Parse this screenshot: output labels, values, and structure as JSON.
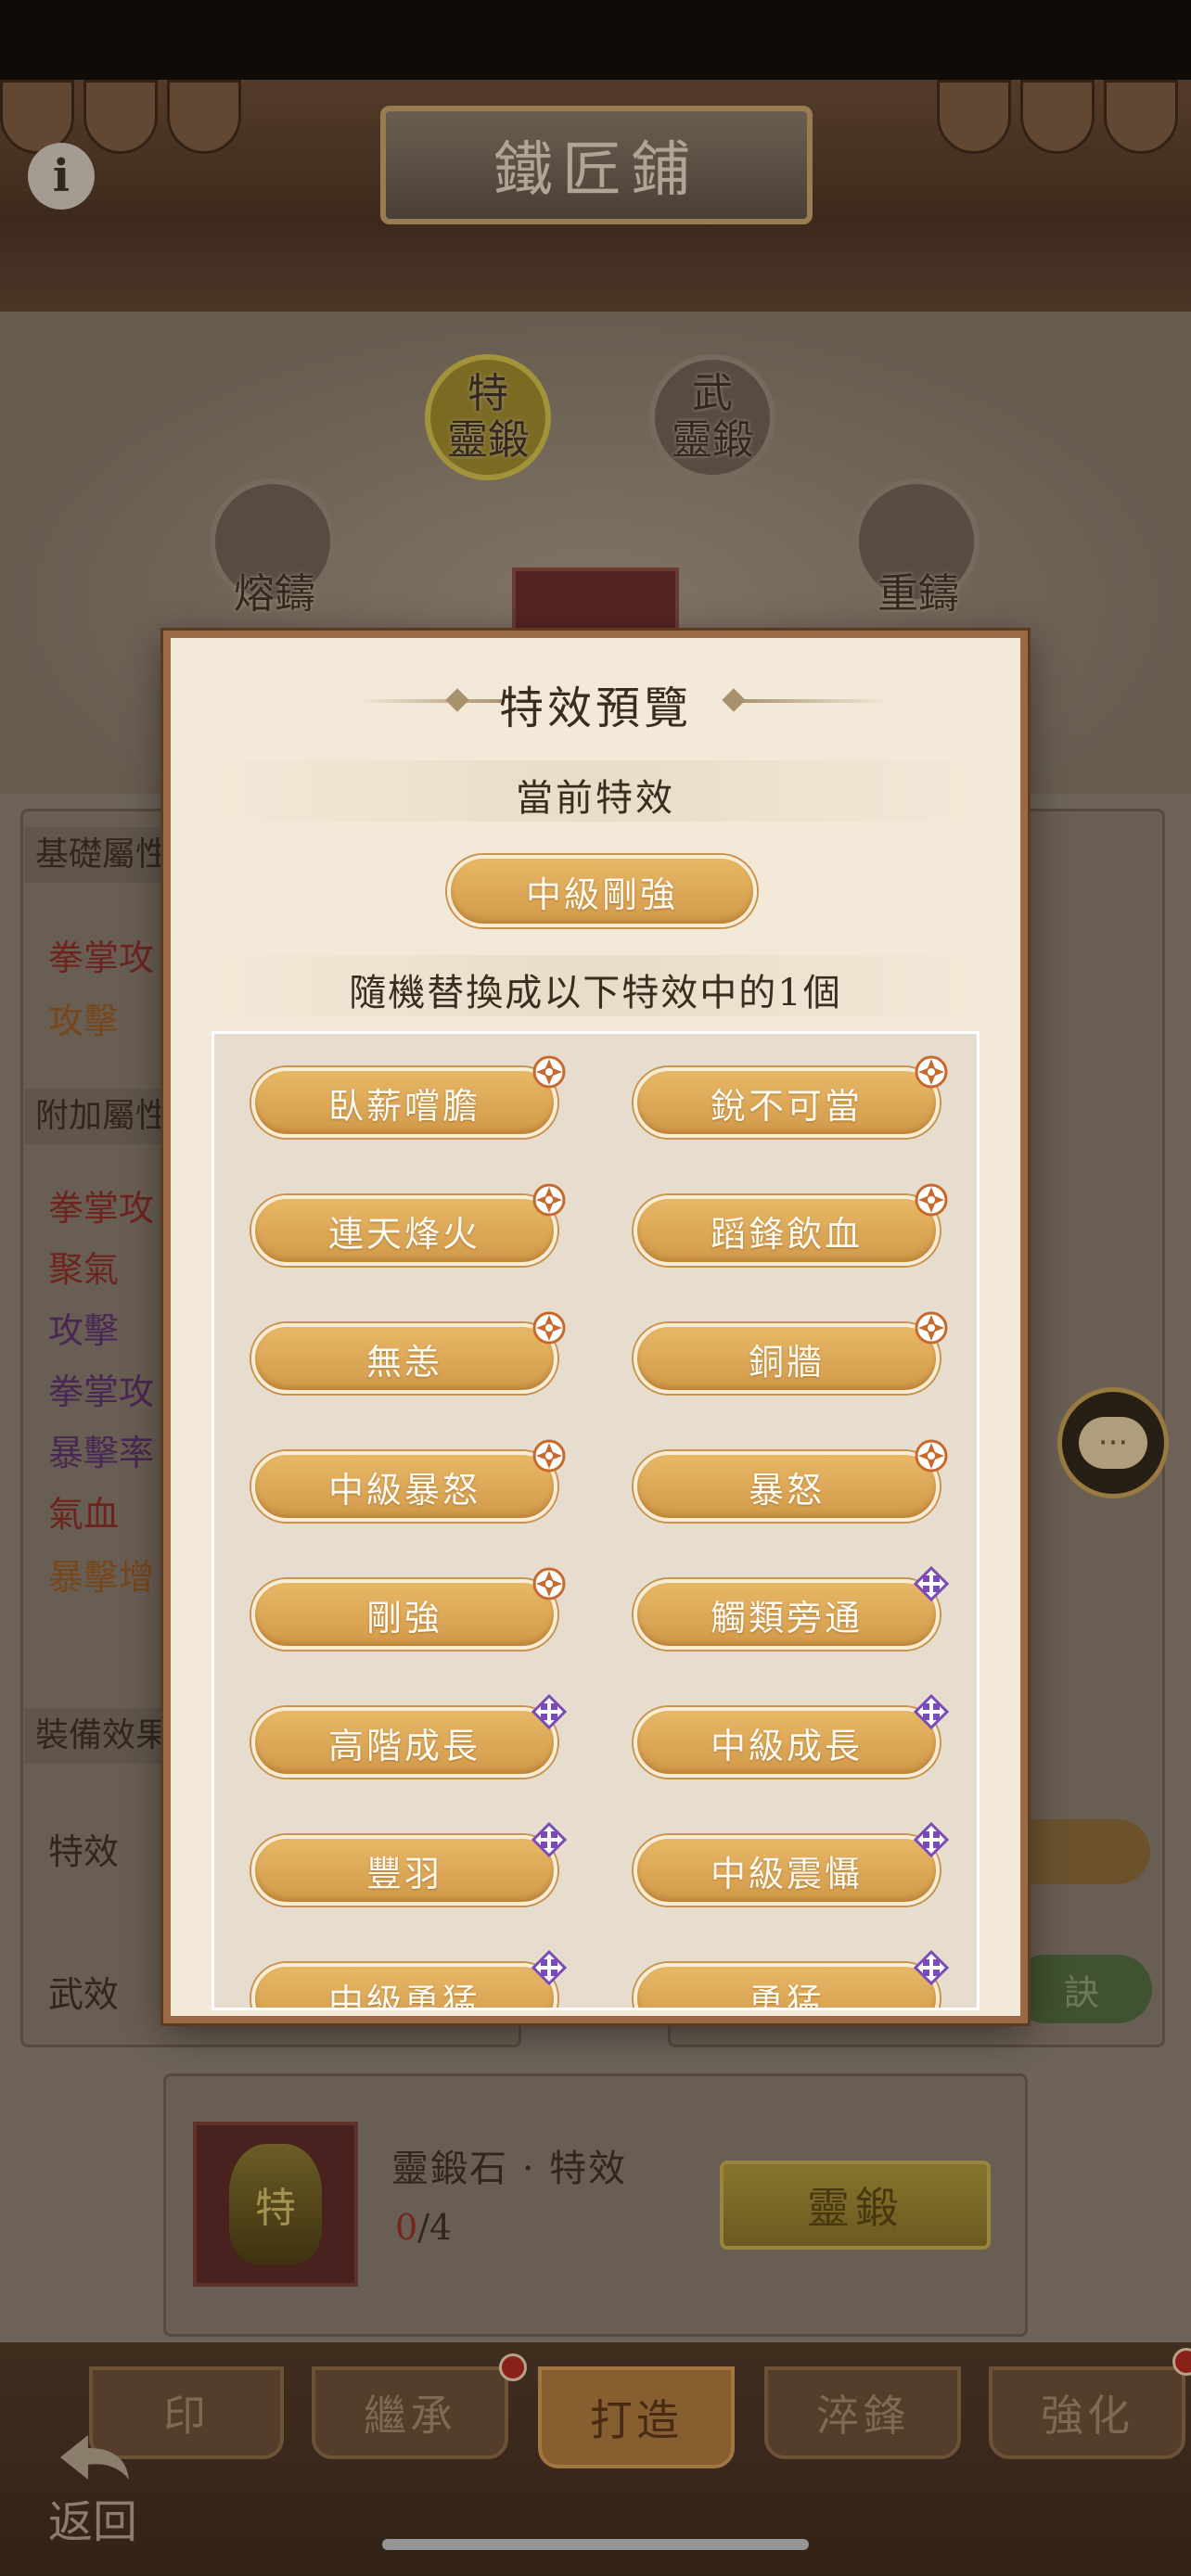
{
  "header": {
    "title": "鐵匠鋪"
  },
  "crafting_wheel": {
    "nodes": [
      {
        "label": "特\n靈鍛",
        "active": true
      },
      {
        "label": "武\n靈鍛",
        "active": false
      },
      {
        "label": "熔鑄",
        "active": false
      },
      {
        "label": "重鑄",
        "active": false
      }
    ]
  },
  "left_panel": {
    "base_header": "基礎屬性",
    "base_stats": [
      "拳掌攻",
      "攻擊"
    ],
    "extra_header": "附加屬性",
    "extra_stats": [
      "拳掌攻",
      "聚氣",
      "攻擊",
      "拳掌攻",
      "暴擊率",
      "氣血",
      "暴擊增"
    ],
    "equip_header": "裝備效果",
    "special_label": "特效",
    "martial_label": "武效"
  },
  "right_panel": {
    "button_text": "訣"
  },
  "material": {
    "name": "靈鍛石 · 特效",
    "count_have": "0",
    "count_need": "/4",
    "item_glyph": "特",
    "action_label": "靈鍛"
  },
  "modal": {
    "title": "特效預覽",
    "current_heading": "當前特效",
    "current_effect": "中級剛強",
    "random_heading": "隨機替換成以下特效中的1個",
    "effects": [
      {
        "label": "臥薪嚐膽",
        "rarity": "orange"
      },
      {
        "label": "銳不可當",
        "rarity": "orange"
      },
      {
        "label": "連天烽火",
        "rarity": "orange"
      },
      {
        "label": "蹈鋒飲血",
        "rarity": "orange"
      },
      {
        "label": "無恙",
        "rarity": "orange"
      },
      {
        "label": "銅牆",
        "rarity": "orange"
      },
      {
        "label": "中級暴怒",
        "rarity": "orange"
      },
      {
        "label": "暴怒",
        "rarity": "orange"
      },
      {
        "label": "剛強",
        "rarity": "orange"
      },
      {
        "label": "觸類旁通",
        "rarity": "purple"
      },
      {
        "label": "高階成長",
        "rarity": "purple"
      },
      {
        "label": "中級成長",
        "rarity": "purple"
      },
      {
        "label": "豐羽",
        "rarity": "purple"
      },
      {
        "label": "中級震懾",
        "rarity": "purple"
      },
      {
        "label": "中級勇猛",
        "rarity": "purple"
      },
      {
        "label": "勇猛",
        "rarity": "purple"
      }
    ],
    "rarity_colors": {
      "orange": "#c8682a",
      "purple": "#7a4ab8"
    }
  },
  "bottom_nav": {
    "tabs": [
      {
        "label": "印",
        "active": false
      },
      {
        "label": "繼承",
        "active": false,
        "badge": true
      },
      {
        "label": "打造",
        "active": true
      },
      {
        "label": "淬鋒",
        "active": false
      },
      {
        "label": "強化",
        "active": false,
        "badge": true
      }
    ],
    "back_label": "返回"
  },
  "chat": {
    "icon": "chat-bubble-icon",
    "glyph": "···"
  }
}
